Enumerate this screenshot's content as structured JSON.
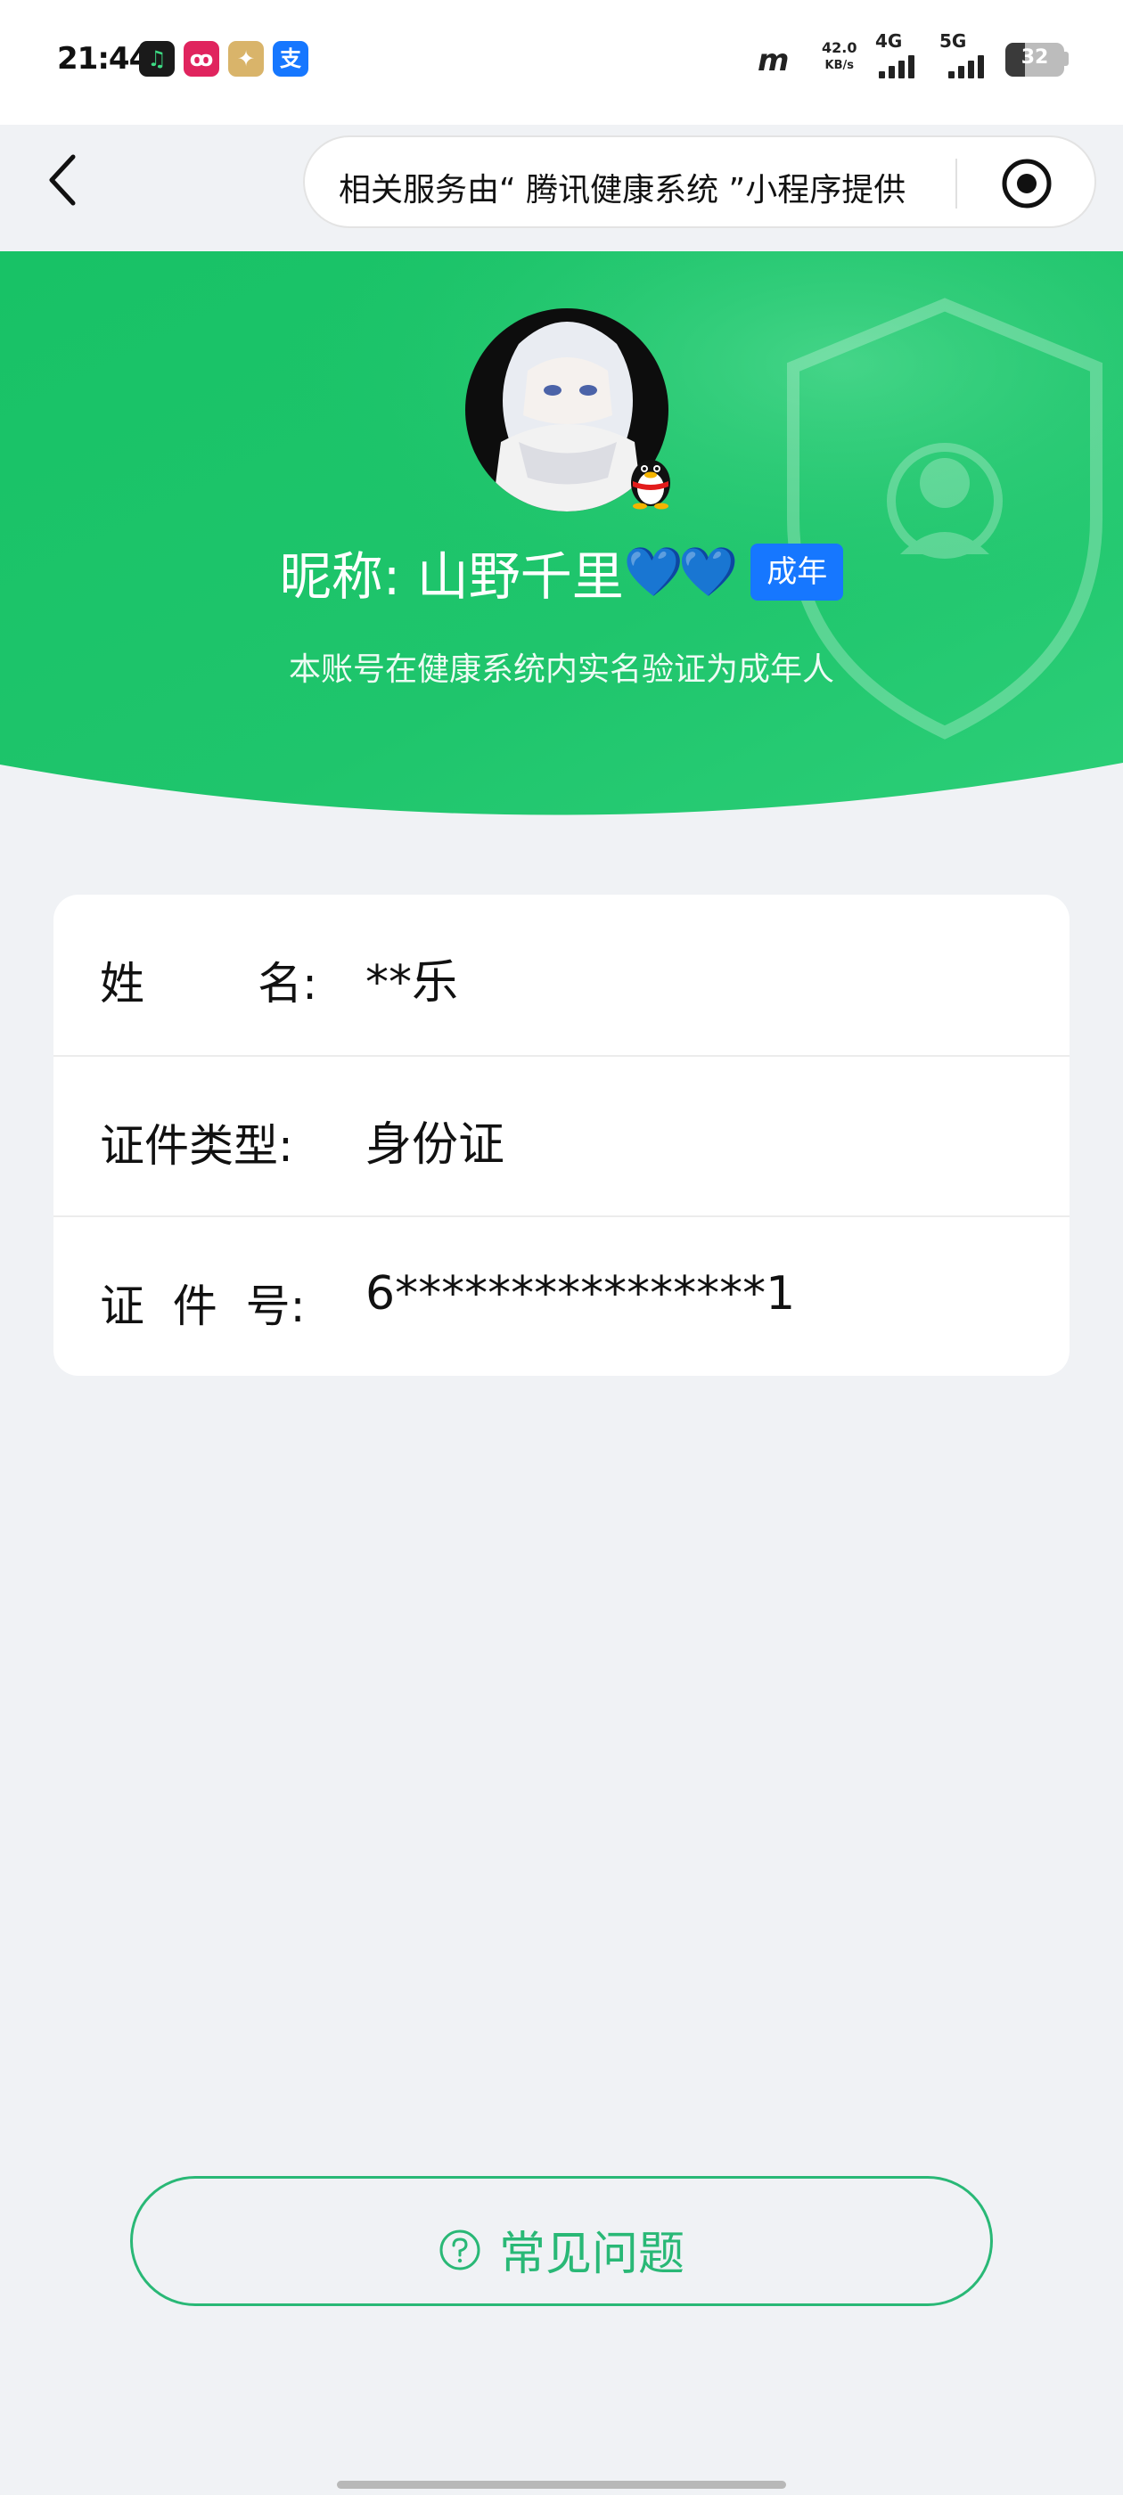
{
  "status_bar": {
    "time": "21:44",
    "apps": [
      {
        "name": "music-app-icon",
        "glyph": "♫",
        "color": "#1a1a1a"
      },
      {
        "name": "social-app-icon",
        "glyph": "ꝏ",
        "color": "#e0245e"
      },
      {
        "name": "game-app-icon",
        "glyph": "✦",
        "color": "#d9b46a"
      },
      {
        "name": "alipay-app-icon",
        "glyph": "支",
        "color": "#1677ff"
      }
    ],
    "speed_value": "42.0",
    "speed_unit": "KB/s",
    "network_1": "4G",
    "network_2": "5G",
    "battery": "32"
  },
  "header": {
    "provider_text": "相关服务由“ 腾讯健康系统 ”小程序提供"
  },
  "hero": {
    "nickname": "昵称: 山野千里",
    "hearts": "💙💙",
    "badge": "成年",
    "description": "本账号在健康系统内实名验证为成年人"
  },
  "info": {
    "rows": [
      {
        "label": "姓        名:",
        "value": "**乐"
      },
      {
        "label": "证件类型:",
        "value": "身份证"
      },
      {
        "label": "证  件  号:",
        "value": "6****************1"
      }
    ]
  },
  "faq": {
    "label": "常见问题"
  },
  "colors": {
    "accent": "#29b876",
    "hero_top": "#1fc36a",
    "badge": "#1677ff"
  }
}
